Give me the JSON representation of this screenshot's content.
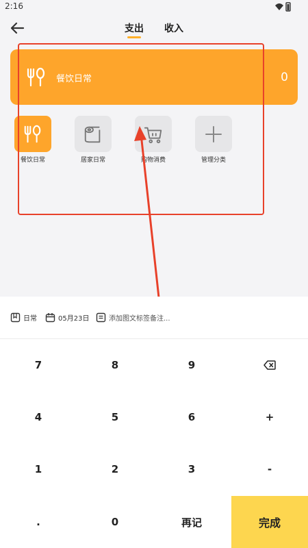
{
  "status": {
    "time": "2:16"
  },
  "header": {
    "tabs": [
      {
        "label": "支出",
        "active": true
      },
      {
        "label": "收入",
        "active": false
      }
    ]
  },
  "selected_category": {
    "name": "餐饮日常",
    "amount": "0"
  },
  "categories": [
    {
      "label": "餐饮日常",
      "icon": "fork-spoon-icon",
      "active": true
    },
    {
      "label": "居家日常",
      "icon": "toilet-paper-icon",
      "active": false
    },
    {
      "label": "购物消费",
      "icon": "shopping-cart-icon",
      "active": false
    },
    {
      "label": "管理分类",
      "icon": "plus-icon",
      "active": false
    }
  ],
  "meta": {
    "book": "日常",
    "date": "05月23日",
    "note_placeholder": "添加图文标签备注..."
  },
  "keypad": {
    "keys": [
      "7",
      "8",
      "9",
      "⌫",
      "4",
      "5",
      "6",
      "+",
      "1",
      "2",
      "3",
      "-",
      ".",
      "0",
      "再记",
      "完成"
    ]
  },
  "colors": {
    "accent": "#fea52b",
    "done": "#fdd64f",
    "annotation": "#e8412a"
  }
}
